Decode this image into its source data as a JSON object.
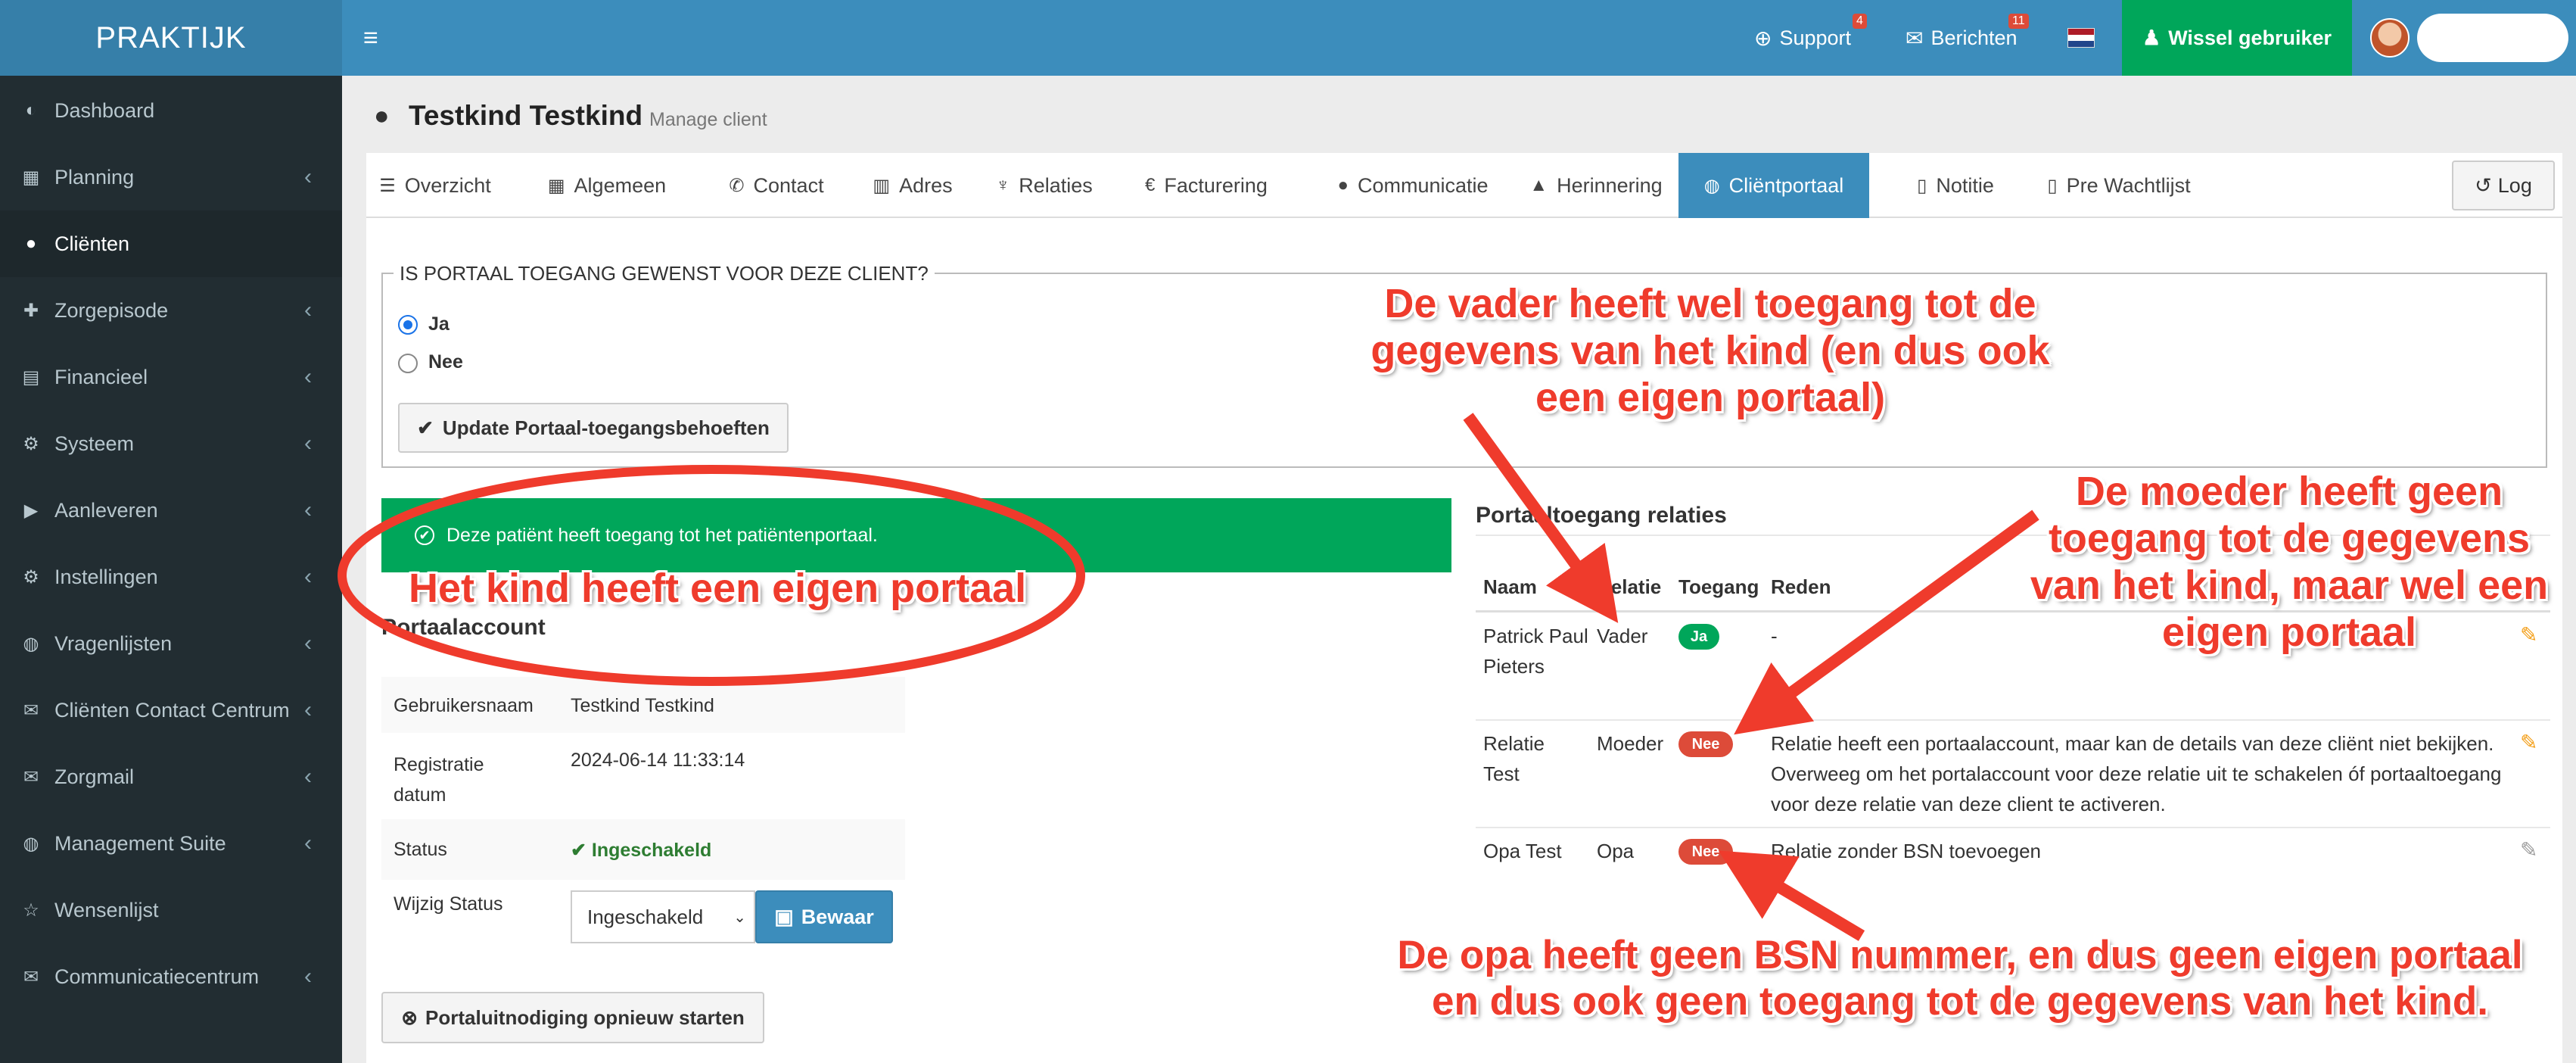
{
  "app": {
    "logo": "PRAKTIJK"
  },
  "sidebar": {
    "items": [
      {
        "label": "Dashboard",
        "icon": "dashboard-icon",
        "glyph": "◐",
        "chevron": false
      },
      {
        "label": "Planning",
        "icon": "calendar-icon",
        "glyph": "▦",
        "chevron": true
      },
      {
        "label": "Cliënten",
        "icon": "user-icon",
        "glyph": "●",
        "chevron": false,
        "active": true
      },
      {
        "label": "Zorgepisode",
        "icon": "medkit-icon",
        "glyph": "✚",
        "chevron": true
      },
      {
        "label": "Financieel",
        "icon": "book-icon",
        "glyph": "▤",
        "chevron": true
      },
      {
        "label": "Systeem",
        "icon": "cogs-icon",
        "glyph": "⚙",
        "chevron": true
      },
      {
        "label": "Aanleveren",
        "icon": "truck-icon",
        "glyph": "▶",
        "chevron": true
      },
      {
        "label": "Instellingen",
        "icon": "gear-icon",
        "glyph": "⚙",
        "chevron": true
      },
      {
        "label": "Vragenlijsten",
        "icon": "globe-icon",
        "glyph": "◍",
        "chevron": true
      },
      {
        "label": "Cliënten Contact Centrum",
        "icon": "envelope-icon",
        "glyph": "✉",
        "chevron": true
      },
      {
        "label": "Zorgmail",
        "icon": "envelope-icon",
        "glyph": "✉",
        "chevron": true
      },
      {
        "label": "Management Suite",
        "icon": "globe-icon",
        "glyph": "◍",
        "chevron": true
      },
      {
        "label": "Wensenlijst",
        "icon": "star-icon",
        "glyph": "☆",
        "chevron": false
      },
      {
        "label": "Communicatiecentrum",
        "icon": "envelope-icon",
        "glyph": "✉",
        "chevron": true
      }
    ]
  },
  "topbar": {
    "support_label": "Support",
    "support_badge": "4",
    "berichten_label": "Berichten",
    "berichten_badge": "11",
    "switch_user_label": "Wissel gebruiker"
  },
  "header": {
    "title": "Testkind Testkind",
    "subtitle": "Manage client"
  },
  "tabs": [
    {
      "label": "Overzicht",
      "glyph": "☰"
    },
    {
      "label": "Algemeen",
      "glyph": "▦"
    },
    {
      "label": "Contact",
      "glyph": "✆"
    },
    {
      "label": "Adres",
      "glyph": "▥"
    },
    {
      "label": "Relaties",
      "glyph": "♆"
    },
    {
      "label": "Facturering",
      "glyph": "€"
    },
    {
      "label": "Communicatie",
      "glyph": "●"
    },
    {
      "label": "Herinnering",
      "glyph": "▲"
    },
    {
      "label": "Cliëntportaal",
      "glyph": "◍",
      "active": true
    },
    {
      "label": "Notitie",
      "glyph": "▯"
    },
    {
      "label": "Pre Wachtlijst",
      "glyph": "▯"
    }
  ],
  "log_label": "Log",
  "portal_question": {
    "legend": "IS PORTAAL TOEGANG GEWENST VOOR DEZE CLIENT?",
    "options": [
      "Ja",
      "Nee"
    ],
    "selected": "Ja",
    "update_button": "Update Portaal-toegangsbehoeften"
  },
  "alert_text": "Deze patiënt heeft toegang tot het patiëntenportaal.",
  "account": {
    "title": "Portaalaccount",
    "rows": [
      {
        "key": "Gebruikersnaam",
        "value": "Testkind Testkind"
      },
      {
        "key": "Registratie datum",
        "value": "2024-06-14 11:33:14"
      },
      {
        "key": "Status",
        "value": "Ingeschakeld"
      },
      {
        "key": "Wijzig Status",
        "value": ""
      }
    ],
    "status_select": "Ingeschakeld",
    "save_button": "Bewaar",
    "restart_button": "Portaluitnodiging opnieuw starten"
  },
  "relations": {
    "title": "Portaaltoegang relaties",
    "columns": [
      "Naam",
      "Relatie",
      "Toegang",
      "Reden"
    ],
    "rows": [
      {
        "naam": "Patrick Paul Pieters",
        "relatie": "Vader",
        "toegang": "Ja",
        "reden": "-"
      },
      {
        "naam": "Relatie Test",
        "relatie": "Moeder",
        "toegang": "Nee",
        "reden": "Relatie heeft een portaalaccount, maar kan de details van deze cliënt niet bekijken. Overweeg om het portalaccount voor deze relatie uit te schakelen óf portaaltoegang voor deze relatie van deze client te activeren."
      },
      {
        "naam": "Opa Test",
        "relatie": "Opa",
        "toegang": "Nee",
        "reden": "Relatie zonder BSN toevoegen"
      }
    ]
  },
  "annotations": {
    "kind": "Het kind heeft een eigen portaal",
    "vader": "De vader heeft wel toegang tot de gegevens van het kind (en dus ook een eigen portaal)",
    "moeder": "De moeder heeft geen toegang tot de gegevens van het kind, maar wel een eigen portaal",
    "opa": "De opa heeft geen BSN nummer, en dus geen eigen portaal en dus ook geen toegang tot de gegevens van het kind."
  },
  "colors": {
    "primary": "#3c8dbc",
    "sidebar": "#222d32",
    "success": "#00a65a",
    "danger": "#dd4b39",
    "annotation": "#ef3b2c"
  }
}
